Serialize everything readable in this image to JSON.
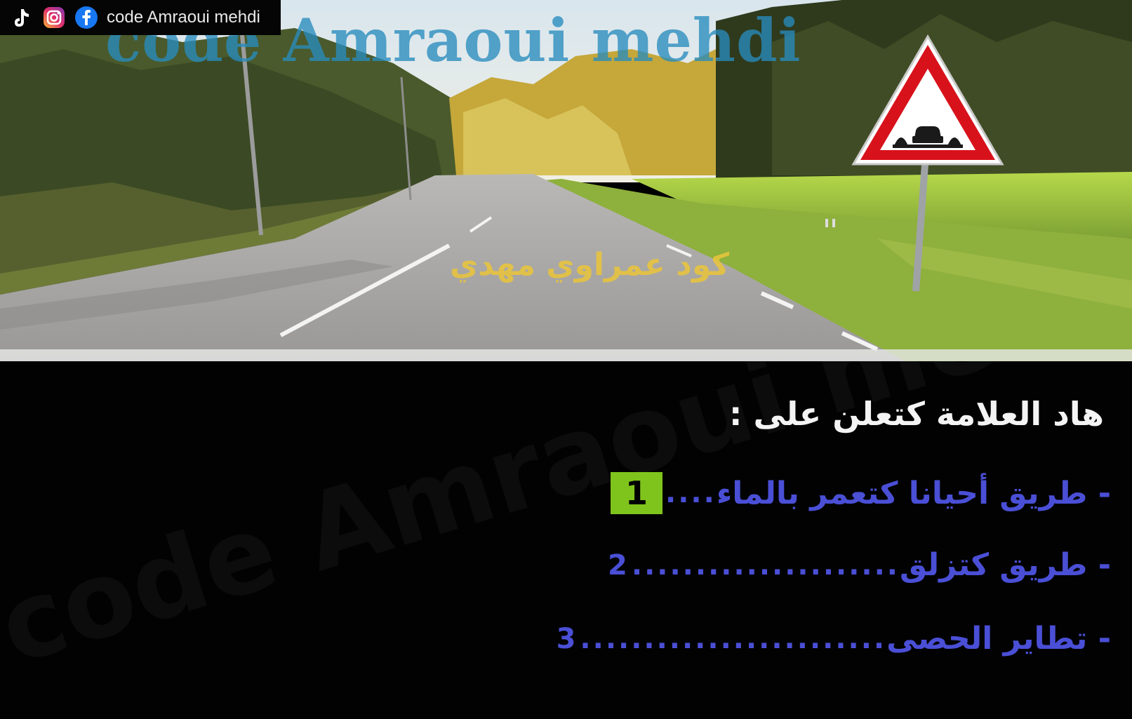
{
  "social": {
    "tiktok_icon": "tiktok-icon",
    "instagram_icon": "instagram-icon",
    "facebook_icon": "facebook-icon",
    "handle": "code Amraoui mehdi"
  },
  "watermark": {
    "top": "code Amraoui mehdi",
    "bottom": "code Amraoui mehdi",
    "caption_ar": "كود عمراوي مهدي"
  },
  "sign": {
    "icon": "uneven-road-sign-icon",
    "border_color": "#d8121b"
  },
  "question": {
    "prompt": "هاد العلامة كتعلن على :"
  },
  "answers": [
    {
      "number": "1",
      "dots": "....",
      "text": "- طريق أحيانا كتعمر بالماء",
      "selected": true
    },
    {
      "number": "2",
      "dots": ".....................",
      "text": "- طريق كتزلق",
      "selected": false
    },
    {
      "number": "3",
      "dots": "........................",
      "text": "- تطاير الحصى",
      "selected": false
    }
  ],
  "colors": {
    "answer_text": "#4a4fd6",
    "selected_badge": "#7fc41c",
    "panel_bg": "#020202"
  }
}
